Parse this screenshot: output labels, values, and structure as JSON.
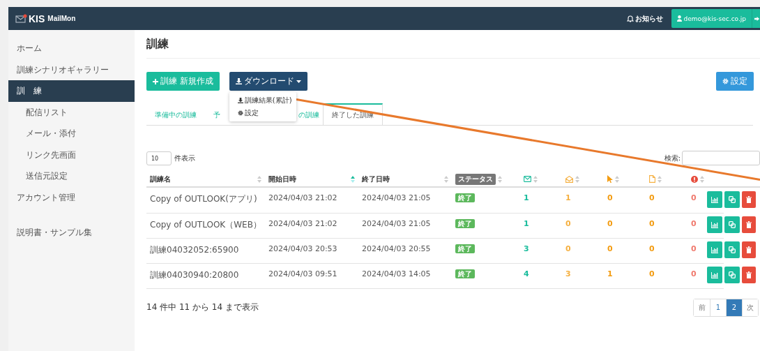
{
  "header": {
    "logo_strong": "KIS",
    "logo_text": "MailMon",
    "notice": "お知らせ",
    "user": "demo@kis-sec.co.jp"
  },
  "sidebar": {
    "items": [
      {
        "label": "ホーム",
        "selected": false
      },
      {
        "label": "訓練シナリオギャラリー",
        "selected": false
      },
      {
        "label": "訓　練",
        "selected": true,
        "children": [
          {
            "label": "配信リスト",
            "selected": false
          },
          {
            "label": "メール・添付",
            "selected": false
          },
          {
            "label": "リンク先画面",
            "selected": false
          },
          {
            "label": "送信元設定",
            "selected": false
          }
        ]
      },
      {
        "label": "アカウント管理",
        "selected": false
      },
      {
        "label": "説明書・サンプル集",
        "selected": false
      }
    ]
  },
  "page": {
    "title": "訓練"
  },
  "toolbar": {
    "new_button": "訓練 新規作成",
    "download_button": "ダウンロード",
    "settings_button": "設定"
  },
  "download_menu": {
    "items": [
      {
        "label": "訓練結果(累計)",
        "kind": "download"
      },
      {
        "label": "設定",
        "kind": "settings"
      }
    ]
  },
  "tabs": [
    {
      "label": "準備中の訓練",
      "selected": false
    },
    {
      "label": "予",
      "selected": false
    },
    {
      "label": "の訓練",
      "selected": false
    },
    {
      "label": "終了した訓練",
      "selected": true
    }
  ],
  "length_control": {
    "value": "10",
    "label": "件表示"
  },
  "search": {
    "label": "検索:"
  },
  "table": {
    "columns": [
      {
        "label": "訓練名",
        "kind": "text",
        "sorted": false
      },
      {
        "label": "開始日時",
        "kind": "text",
        "sorted": true
      },
      {
        "label": "終了日時",
        "kind": "text",
        "sorted": false
      },
      {
        "label": "ステータス",
        "kind": "badge",
        "sorted": false
      },
      {
        "kind": "sent",
        "sorted": false
      },
      {
        "kind": "opened",
        "sorted": false
      },
      {
        "kind": "clicked",
        "sorted": false
      },
      {
        "kind": "attachment",
        "sorted": false
      },
      {
        "kind": "error",
        "sorted": false
      }
    ],
    "rows": [
      {
        "name": "Copy of OUTLOOK(アプリ)",
        "start": "2024/04/03 21:02",
        "end": "2024/04/03 21:05",
        "status": "終了",
        "counts": [
          "1",
          "1",
          "0",
          "0",
          "0"
        ]
      },
      {
        "name": "Copy of OUTLOOK（WEB）",
        "start": "2024/04/03 21:02",
        "end": "2024/04/03 21:05",
        "status": "終了",
        "counts": [
          "1",
          "0",
          "0",
          "0",
          "0"
        ]
      },
      {
        "name": "訓練04032052:65900",
        "start": "2024/04/03 20:53",
        "end": "2024/04/03 20:55",
        "status": "終了",
        "counts": [
          "3",
          "0",
          "0",
          "0",
          "0"
        ]
      },
      {
        "name": "訓練04030940:20800",
        "start": "2024/04/03 09:51",
        "end": "2024/04/03 14:05",
        "status": "終了",
        "counts": [
          "4",
          "3",
          "1",
          "0",
          "0"
        ]
      }
    ]
  },
  "info": "14 件中 11 から 14 まで表示",
  "pagination": [
    {
      "label": "前",
      "selected": false
    },
    {
      "label": "1",
      "selected": false
    },
    {
      "label": "2",
      "selected": true
    },
    {
      "label": "次",
      "selected": false
    }
  ]
}
